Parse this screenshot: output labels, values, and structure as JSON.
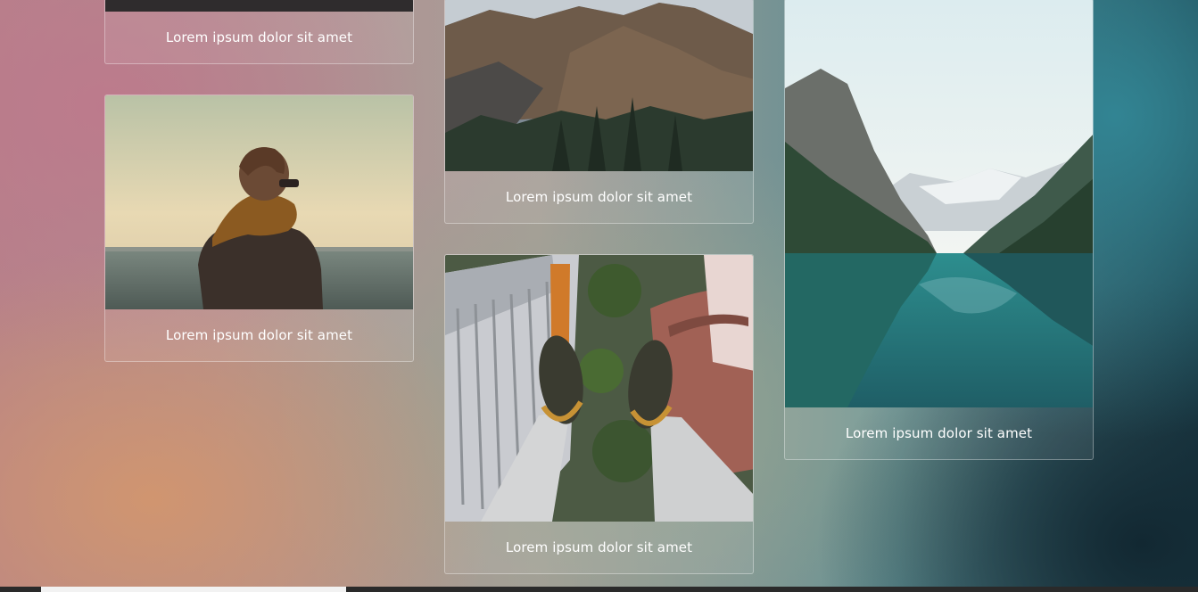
{
  "gallery": {
    "cards": [
      {
        "caption": "Lorem ipsum dolor sit amet",
        "photo": "dark-photo"
      },
      {
        "caption": "Lorem ipsum dolor sit amet",
        "photo": "woman-by-sea-photo"
      },
      {
        "caption": "Lorem ipsum dolor sit amet",
        "photo": "mountain-valley-photo"
      },
      {
        "caption": "Lorem ipsum dolor sit amet",
        "photo": "feet-over-city-photo"
      },
      {
        "caption": "Lorem ipsum dolor sit amet",
        "photo": "mountain-lake-photo"
      }
    ]
  },
  "colors": {
    "caption_text": "#ffffff",
    "card_border": "rgba(255,255,255,0.35)"
  }
}
